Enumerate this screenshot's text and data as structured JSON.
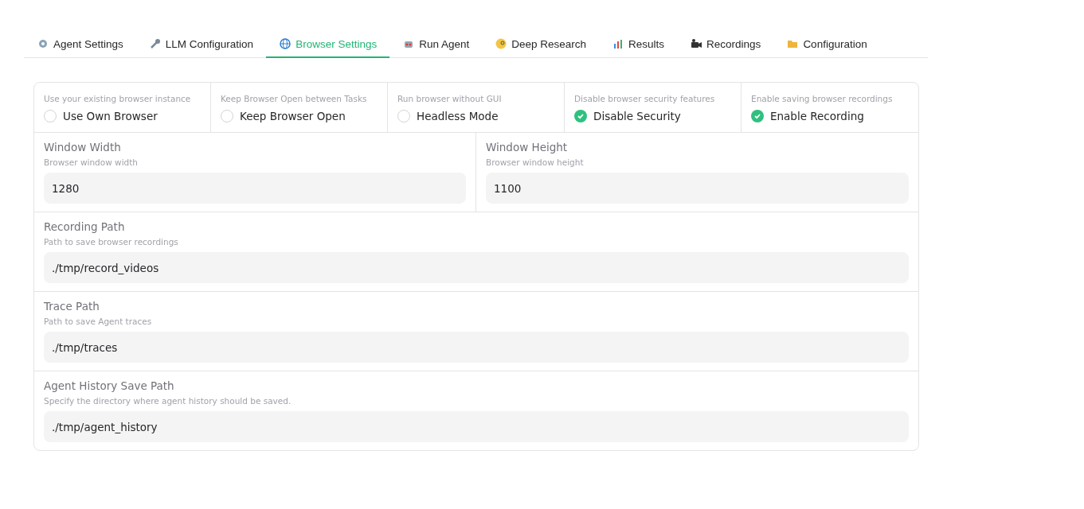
{
  "tabs": [
    {
      "label": "Agent Settings",
      "selected": false
    },
    {
      "label": "LLM Configuration",
      "selected": false
    },
    {
      "label": "Browser Settings",
      "selected": true
    },
    {
      "label": "Run Agent",
      "selected": false
    },
    {
      "label": "Deep Research",
      "selected": false
    },
    {
      "label": "Results",
      "selected": false
    },
    {
      "label": "Recordings",
      "selected": false
    },
    {
      "label": "Configuration",
      "selected": false
    }
  ],
  "checkboxes": [
    {
      "hint": "Use your existing browser instance",
      "label": "Use Own Browser",
      "checked": false
    },
    {
      "hint": "Keep Browser Open between Tasks",
      "label": "Keep Browser Open",
      "checked": false
    },
    {
      "hint": "Run browser without GUI",
      "label": "Headless Mode",
      "checked": false
    },
    {
      "hint": "Disable browser security features",
      "label": "Disable Security",
      "checked": true
    },
    {
      "hint": "Enable saving browser recordings",
      "label": "Enable Recording",
      "checked": true
    }
  ],
  "size_fields": [
    {
      "label": "Window Width",
      "hint": "Browser window width",
      "value": "1280"
    },
    {
      "label": "Window Height",
      "hint": "Browser window height",
      "value": "1100"
    }
  ],
  "path_fields": [
    {
      "label": "Recording Path",
      "hint": "Path to save browser recordings",
      "value": "./tmp/record_videos"
    },
    {
      "label": "Trace Path",
      "hint": "Path to save Agent traces",
      "value": "./tmp/traces"
    },
    {
      "label": "Agent History Save Path",
      "hint": "Specify the directory where agent history should be saved.",
      "value": "./tmp/agent_history"
    }
  ]
}
